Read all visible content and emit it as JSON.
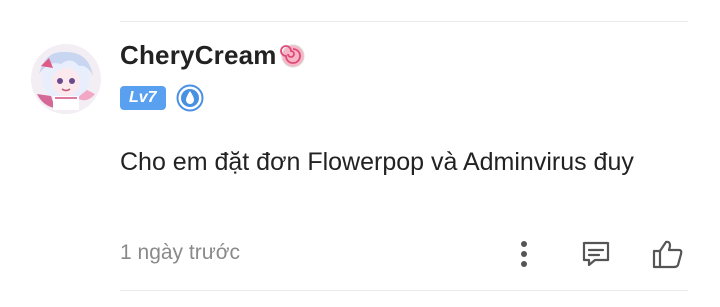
{
  "comment": {
    "username": "CheryCream",
    "level": "Lv7",
    "text": "Cho em đặt đơn Flowerpop và Adminvirus đuy",
    "timestamp": "1 ngày trước"
  },
  "icons": {
    "username_decoration": "lollipop-candy-icon",
    "member_badge": "blue-drop-badge-icon",
    "more": "more-vertical-icon",
    "reply": "comment-reply-icon",
    "like": "thumbs-up-icon"
  },
  "colors": {
    "level_badge": "#5aa0f0",
    "text": "#222222",
    "muted": "#8a8a8a",
    "icon": "#555555"
  }
}
